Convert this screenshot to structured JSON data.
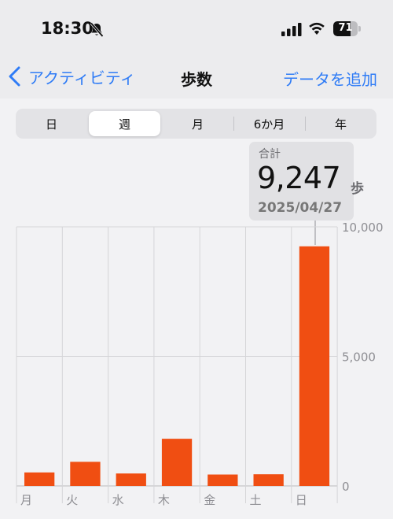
{
  "status_bar": {
    "time": "18:30",
    "battery": "71",
    "battery_level": 0.71,
    "icons": [
      "bell-slash-icon",
      "cellular-signal-icon",
      "wifi-icon",
      "battery-icon"
    ]
  },
  "nav": {
    "back_label": "アクティビティ",
    "title": "歩数",
    "action_label": "データを追加",
    "accent_color": "#2f7cf6"
  },
  "segments": {
    "items": [
      "日",
      "週",
      "月",
      "6か月",
      "年"
    ],
    "selected": "週"
  },
  "summary": {
    "label": "合計",
    "value": "9,247",
    "unit": "歩",
    "date": "2025/04/27"
  },
  "chart_data": {
    "type": "bar",
    "categories": [
      "月",
      "火",
      "水",
      "木",
      "金",
      "土",
      "日"
    ],
    "values": [
      520,
      930,
      480,
      1820,
      440,
      450,
      9247
    ],
    "yticks": [
      "10,000",
      "5,000",
      "0"
    ],
    "ylim": [
      0,
      10000
    ],
    "bar_color": "#f04e12",
    "grid": true,
    "highlighted_category": "日"
  }
}
